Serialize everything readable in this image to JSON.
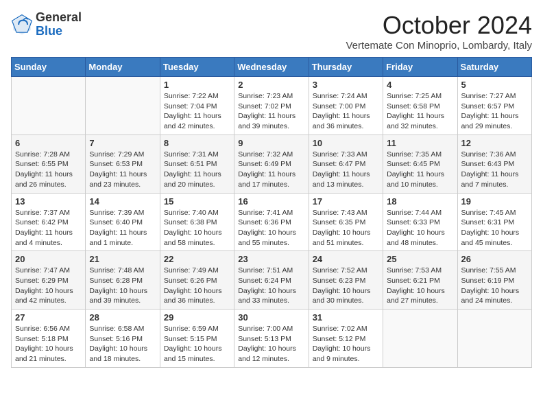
{
  "logo": {
    "general": "General",
    "blue": "Blue"
  },
  "title": "October 2024",
  "subtitle": "Vertemate Con Minoprio, Lombardy, Italy",
  "days_of_week": [
    "Sunday",
    "Monday",
    "Tuesday",
    "Wednesday",
    "Thursday",
    "Friday",
    "Saturday"
  ],
  "weeks": [
    [
      {
        "day": "",
        "info": ""
      },
      {
        "day": "",
        "info": ""
      },
      {
        "day": "1",
        "info": "Sunrise: 7:22 AM\nSunset: 7:04 PM\nDaylight: 11 hours and 42 minutes."
      },
      {
        "day": "2",
        "info": "Sunrise: 7:23 AM\nSunset: 7:02 PM\nDaylight: 11 hours and 39 minutes."
      },
      {
        "day": "3",
        "info": "Sunrise: 7:24 AM\nSunset: 7:00 PM\nDaylight: 11 hours and 36 minutes."
      },
      {
        "day": "4",
        "info": "Sunrise: 7:25 AM\nSunset: 6:58 PM\nDaylight: 11 hours and 32 minutes."
      },
      {
        "day": "5",
        "info": "Sunrise: 7:27 AM\nSunset: 6:57 PM\nDaylight: 11 hours and 29 minutes."
      }
    ],
    [
      {
        "day": "6",
        "info": "Sunrise: 7:28 AM\nSunset: 6:55 PM\nDaylight: 11 hours and 26 minutes."
      },
      {
        "day": "7",
        "info": "Sunrise: 7:29 AM\nSunset: 6:53 PM\nDaylight: 11 hours and 23 minutes."
      },
      {
        "day": "8",
        "info": "Sunrise: 7:31 AM\nSunset: 6:51 PM\nDaylight: 11 hours and 20 minutes."
      },
      {
        "day": "9",
        "info": "Sunrise: 7:32 AM\nSunset: 6:49 PM\nDaylight: 11 hours and 17 minutes."
      },
      {
        "day": "10",
        "info": "Sunrise: 7:33 AM\nSunset: 6:47 PM\nDaylight: 11 hours and 13 minutes."
      },
      {
        "day": "11",
        "info": "Sunrise: 7:35 AM\nSunset: 6:45 PM\nDaylight: 11 hours and 10 minutes."
      },
      {
        "day": "12",
        "info": "Sunrise: 7:36 AM\nSunset: 6:43 PM\nDaylight: 11 hours and 7 minutes."
      }
    ],
    [
      {
        "day": "13",
        "info": "Sunrise: 7:37 AM\nSunset: 6:42 PM\nDaylight: 11 hours and 4 minutes."
      },
      {
        "day": "14",
        "info": "Sunrise: 7:39 AM\nSunset: 6:40 PM\nDaylight: 11 hours and 1 minute."
      },
      {
        "day": "15",
        "info": "Sunrise: 7:40 AM\nSunset: 6:38 PM\nDaylight: 10 hours and 58 minutes."
      },
      {
        "day": "16",
        "info": "Sunrise: 7:41 AM\nSunset: 6:36 PM\nDaylight: 10 hours and 55 minutes."
      },
      {
        "day": "17",
        "info": "Sunrise: 7:43 AM\nSunset: 6:35 PM\nDaylight: 10 hours and 51 minutes."
      },
      {
        "day": "18",
        "info": "Sunrise: 7:44 AM\nSunset: 6:33 PM\nDaylight: 10 hours and 48 minutes."
      },
      {
        "day": "19",
        "info": "Sunrise: 7:45 AM\nSunset: 6:31 PM\nDaylight: 10 hours and 45 minutes."
      }
    ],
    [
      {
        "day": "20",
        "info": "Sunrise: 7:47 AM\nSunset: 6:29 PM\nDaylight: 10 hours and 42 minutes."
      },
      {
        "day": "21",
        "info": "Sunrise: 7:48 AM\nSunset: 6:28 PM\nDaylight: 10 hours and 39 minutes."
      },
      {
        "day": "22",
        "info": "Sunrise: 7:49 AM\nSunset: 6:26 PM\nDaylight: 10 hours and 36 minutes."
      },
      {
        "day": "23",
        "info": "Sunrise: 7:51 AM\nSunset: 6:24 PM\nDaylight: 10 hours and 33 minutes."
      },
      {
        "day": "24",
        "info": "Sunrise: 7:52 AM\nSunset: 6:23 PM\nDaylight: 10 hours and 30 minutes."
      },
      {
        "day": "25",
        "info": "Sunrise: 7:53 AM\nSunset: 6:21 PM\nDaylight: 10 hours and 27 minutes."
      },
      {
        "day": "26",
        "info": "Sunrise: 7:55 AM\nSunset: 6:19 PM\nDaylight: 10 hours and 24 minutes."
      }
    ],
    [
      {
        "day": "27",
        "info": "Sunrise: 6:56 AM\nSunset: 5:18 PM\nDaylight: 10 hours and 21 minutes."
      },
      {
        "day": "28",
        "info": "Sunrise: 6:58 AM\nSunset: 5:16 PM\nDaylight: 10 hours and 18 minutes."
      },
      {
        "day": "29",
        "info": "Sunrise: 6:59 AM\nSunset: 5:15 PM\nDaylight: 10 hours and 15 minutes."
      },
      {
        "day": "30",
        "info": "Sunrise: 7:00 AM\nSunset: 5:13 PM\nDaylight: 10 hours and 12 minutes."
      },
      {
        "day": "31",
        "info": "Sunrise: 7:02 AM\nSunset: 5:12 PM\nDaylight: 10 hours and 9 minutes."
      },
      {
        "day": "",
        "info": ""
      },
      {
        "day": "",
        "info": ""
      }
    ]
  ]
}
